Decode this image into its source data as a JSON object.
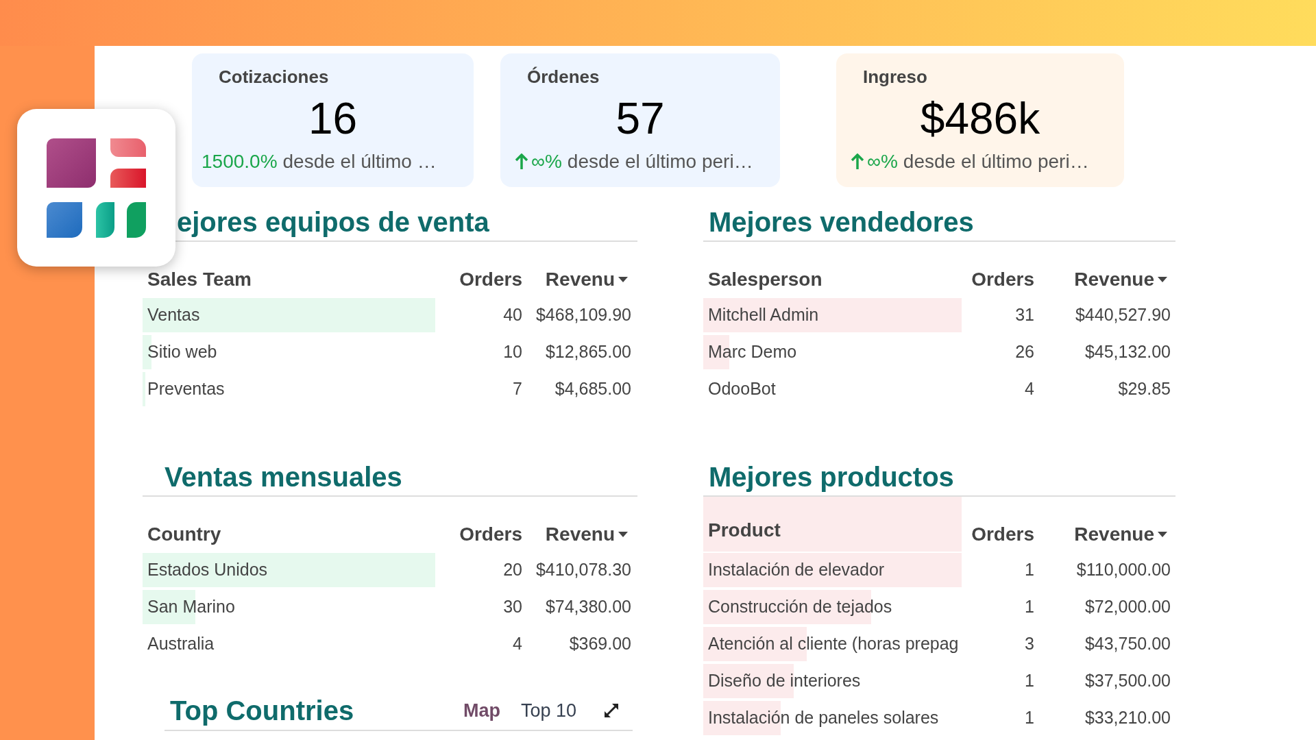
{
  "kpis": [
    {
      "label": "Cotizaciones",
      "value": "16",
      "change": "1500.0%",
      "arrow": false,
      "note": "desde el último …",
      "color": "#eef5ff"
    },
    {
      "label": "Órdenes",
      "value": "57",
      "change": "∞%",
      "arrow": true,
      "note": "desde el último peri…",
      "color": "#eef5ff"
    },
    {
      "label": "Ingreso",
      "value": "$486k",
      "change": "∞%",
      "arrow": true,
      "note": "desde el último peri…",
      "color": "#fff5ea"
    }
  ],
  "tables": [
    {
      "title": "ejores equipos de venta",
      "color": "#e6f9ee",
      "header_bar": false,
      "columns": [
        "Sales Team",
        "Orders",
        "Revenu"
      ],
      "rows": [
        {
          "name": "Ventas",
          "orders": "40",
          "revenue": "$468,109.90",
          "level": 1
        },
        {
          "name": "Sitio web",
          "orders": "10",
          "revenue": "$12,865.00",
          "level": 0.03
        },
        {
          "name": "Preventas",
          "orders": "7",
          "revenue": "$4,685.00",
          "level": 0.01
        }
      ]
    },
    {
      "title": "Mejores vendedores",
      "color": "#fcebec",
      "header_bar": false,
      "columns": [
        "Salesperson",
        "Orders",
        "Revenue"
      ],
      "rows": [
        {
          "name": "Mitchell Admin",
          "orders": "31",
          "revenue": "$440,527.90",
          "level": 1
        },
        {
          "name": "Marc Demo",
          "orders": "26",
          "revenue": "$45,132.00",
          "level": 0.1
        },
        {
          "name": "OdooBot",
          "orders": "4",
          "revenue": "$29.85",
          "level": 0
        }
      ]
    },
    {
      "title": "Ventas mensuales",
      "color": "#e6f9ee",
      "header_bar": false,
      "columns": [
        "Country",
        "Orders",
        "Revenu"
      ],
      "rows": [
        {
          "name": "Estados Unidos",
          "orders": "20",
          "revenue": "$410,078.30",
          "level": 1
        },
        {
          "name": "San Marino",
          "orders": "30",
          "revenue": "$74,380.00",
          "level": 0.18
        },
        {
          "name": "Australia",
          "orders": "4",
          "revenue": "$369.00",
          "level": 0
        }
      ]
    },
    {
      "title": "Mejores productos",
      "color": "#fcebec",
      "header_bar": true,
      "columns": [
        "Product",
        "Orders",
        "Revenue"
      ],
      "rows": [
        {
          "name": "Instalación de elevador",
          "orders": "1",
          "revenue": "$110,000.00",
          "level": 1
        },
        {
          "name": "Construcción de tejados",
          "orders": "1",
          "revenue": "$72,000.00",
          "level": 0.65
        },
        {
          "name": "Atención al cliente (horas prepag",
          "orders": "3",
          "revenue": "$43,750.00",
          "level": 0.4
        },
        {
          "name": "Diseño de interiores",
          "orders": "1",
          "revenue": "$37,500.00",
          "level": 0.35
        },
        {
          "name": "Instalación de paneles solares",
          "orders": "1",
          "revenue": "$33,210.00",
          "level": 0.3
        }
      ]
    }
  ],
  "top_countries": {
    "title": "Top Countries",
    "tabs": [
      {
        "label": "Map",
        "selected": true
      },
      {
        "label": "Top 10",
        "selected": false
      }
    ]
  }
}
